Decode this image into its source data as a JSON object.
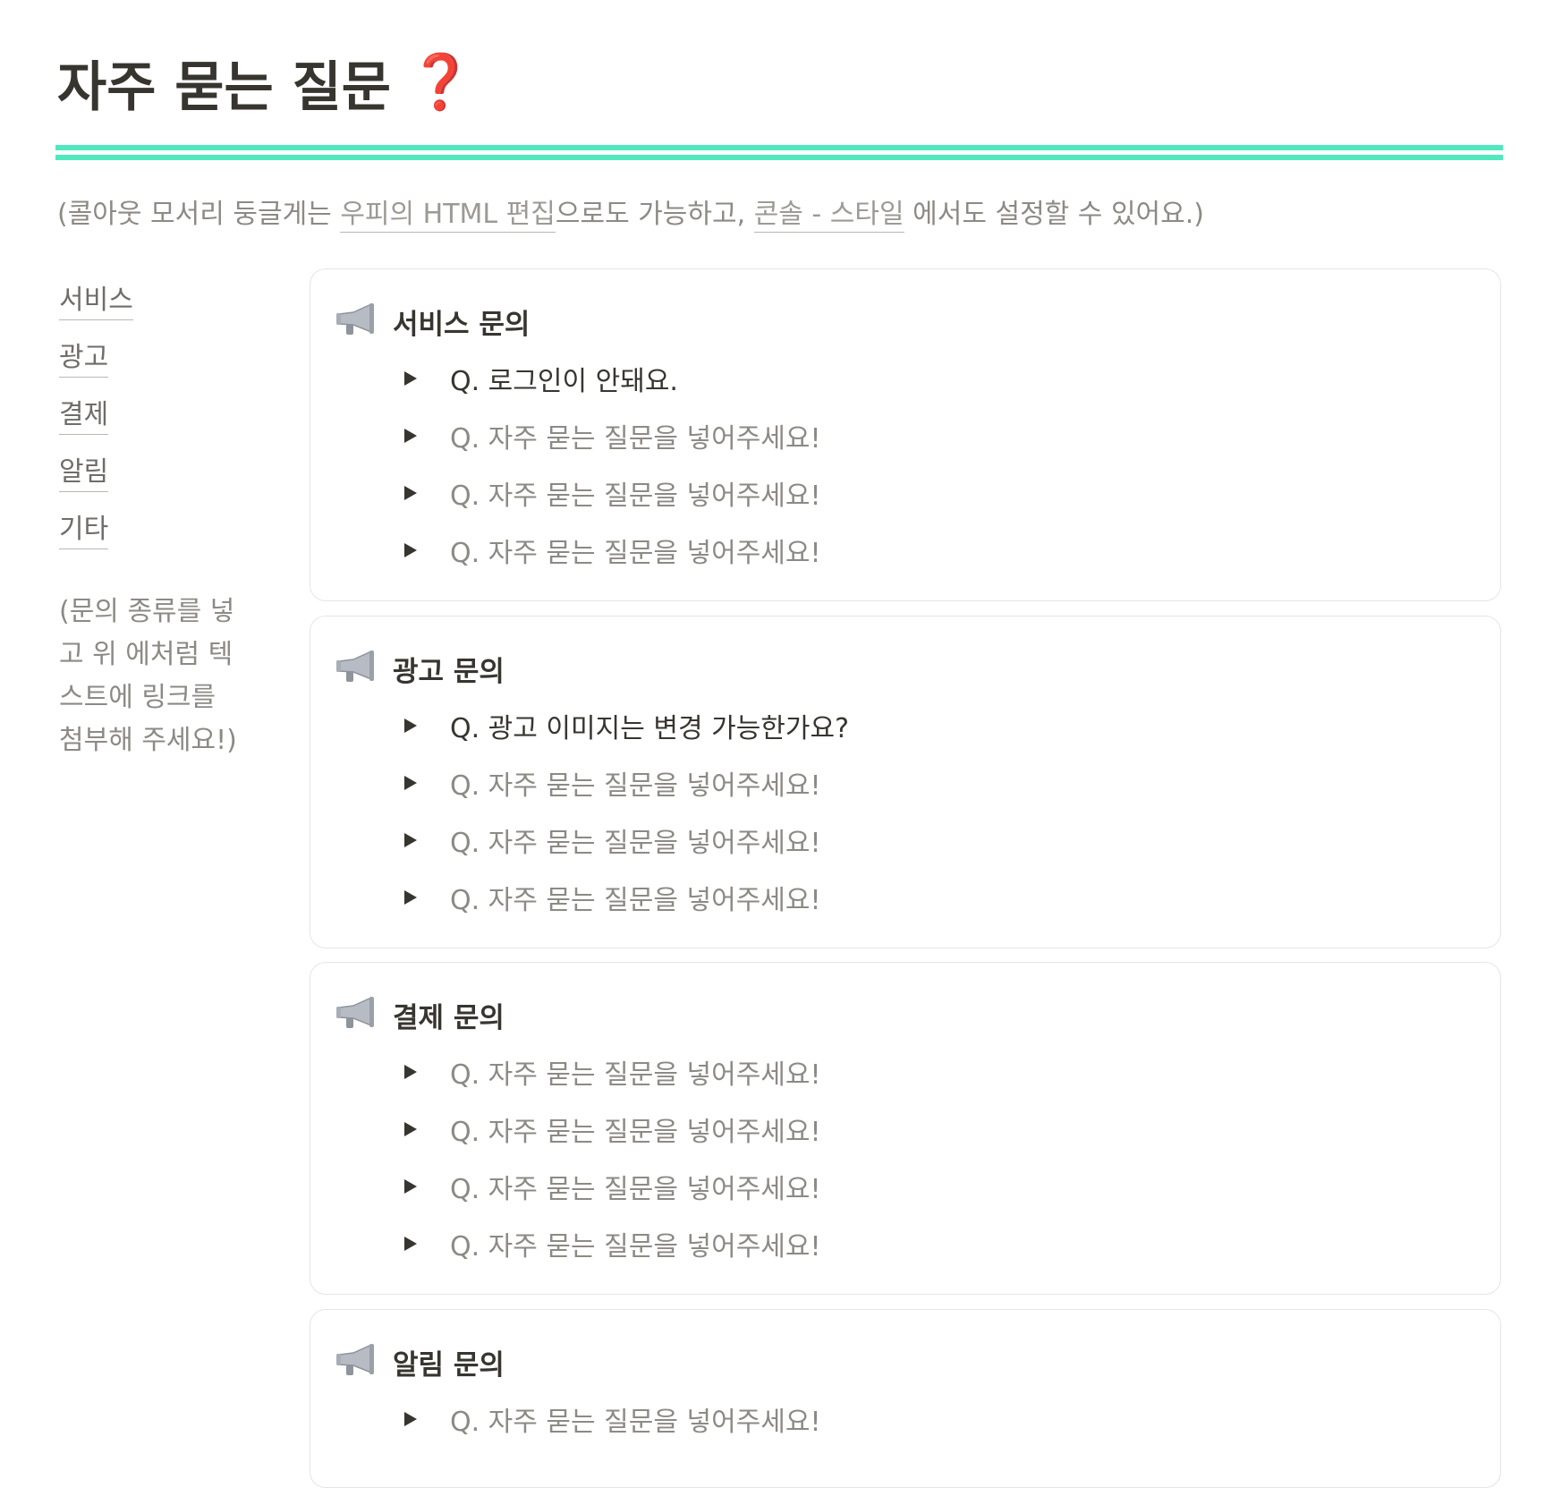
{
  "page": {
    "title": "자주 묻는 질문",
    "title_emoji": "❓",
    "accent_color": "#4fe8bf",
    "emoji_color": "#d80f1a"
  },
  "notice": {
    "prefix": "(콜아웃 모서리 둥글게는 ",
    "link1": "우피의 HTML 편집",
    "middle": "으로도 가능하고, ",
    "link2": "콘솔 - 스타일",
    "suffix": " 에서도 설정할 수 있어요.)"
  },
  "sidebar": {
    "items": [
      {
        "label": "서비스"
      },
      {
        "label": "광고"
      },
      {
        "label": "결제"
      },
      {
        "label": "알림"
      },
      {
        "label": "기타"
      }
    ],
    "note": "(문의 종류를 넣고 위 에처럼 텍스트에 링크를 첨부해 주세요!)"
  },
  "sections": [
    {
      "heading": "서비스 문의",
      "icon": "megaphone-icon",
      "questions": [
        {
          "text": "Q. 로그인이 안돼요."
        },
        {
          "text": "Q. 자주 묻는 질문을 넣어주세요!"
        },
        {
          "text": "Q. 자주 묻는 질문을 넣어주세요!"
        },
        {
          "text": "Q. 자주 묻는 질문을 넣어주세요!"
        }
      ]
    },
    {
      "heading": "광고 문의",
      "icon": "megaphone-icon",
      "questions": [
        {
          "text": "Q. 광고 이미지는 변경 가능한가요?"
        },
        {
          "text": "Q. 자주 묻는 질문을 넣어주세요!"
        },
        {
          "text": "Q. 자주 묻는 질문을 넣어주세요!"
        },
        {
          "text": "Q. 자주 묻는 질문을 넣어주세요!"
        }
      ]
    },
    {
      "heading": "결제 문의",
      "icon": "megaphone-icon",
      "questions": [
        {
          "text": "Q. 자주 묻는 질문을 넣어주세요!"
        },
        {
          "text": "Q. 자주 묻는 질문을 넣어주세요!"
        },
        {
          "text": "Q. 자주 묻는 질문을 넣어주세요!"
        },
        {
          "text": "Q. 자주 묻는 질문을 넣어주세요!"
        }
      ]
    },
    {
      "heading": "알림 문의",
      "icon": "megaphone-icon",
      "questions": [
        {
          "text": "Q. 자주 묻는 질문을 넣어주세요!"
        }
      ]
    }
  ]
}
